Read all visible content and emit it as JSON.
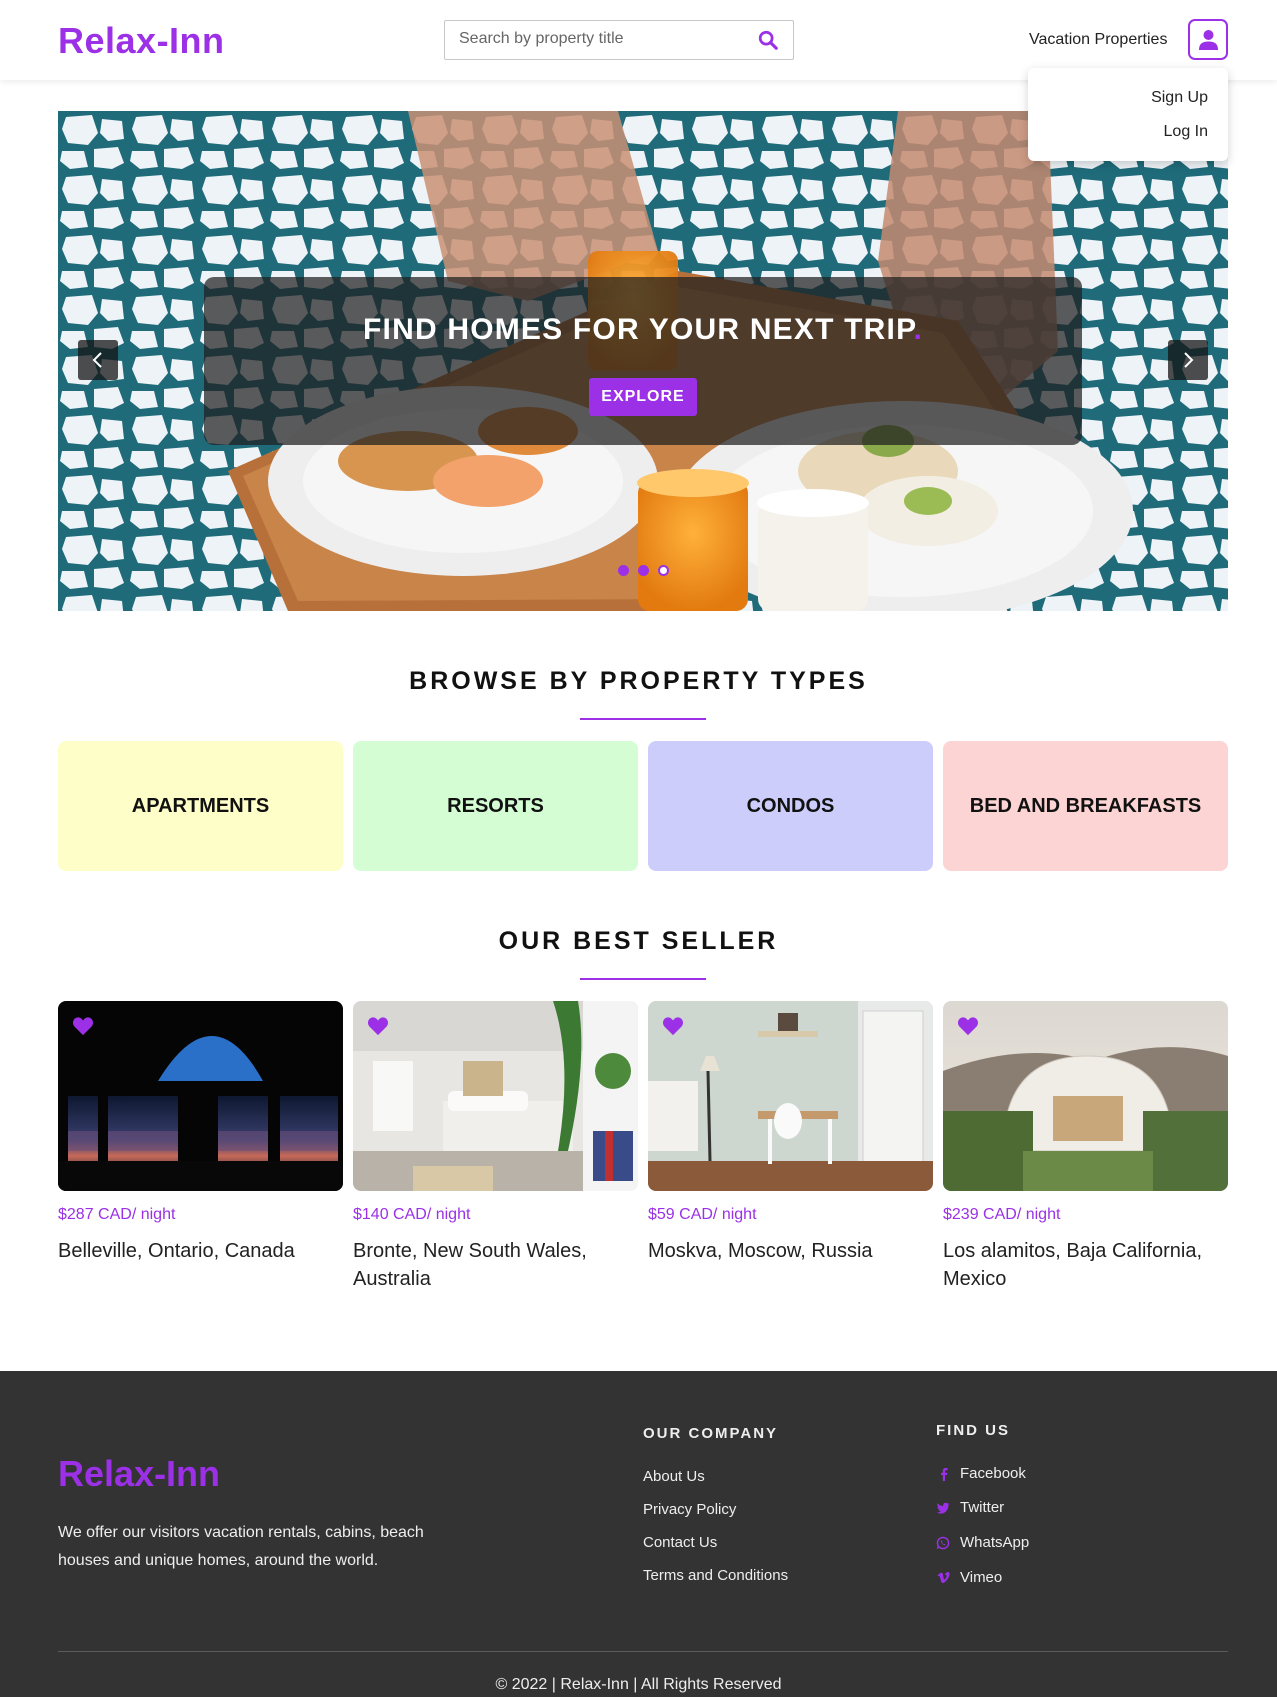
{
  "header": {
    "logo": "Relax-Inn",
    "search_placeholder": "Search by property title",
    "nav_link": "Vacation Properties",
    "dropdown": [
      "Sign Up",
      "Log In"
    ]
  },
  "hero": {
    "title": "FIND HOMES FOR YOUR NEXT TRIP",
    "title_dot": ".",
    "button": "EXPLORE",
    "slides": 3,
    "active_slide": 3
  },
  "property_types": {
    "title": "BROWSE BY PROPERTY TYPES",
    "items": [
      {
        "label": "APARTMENTS",
        "color": "#fefec8"
      },
      {
        "label": "RESORTS",
        "color": "#d4fdd4"
      },
      {
        "label": "CONDOS",
        "color": "#cdcdfc"
      },
      {
        "label": "BED AND BREAKFASTS",
        "color": "#fdd4d4"
      }
    ]
  },
  "best_seller": {
    "title": "OUR BEST SELLER",
    "items": [
      {
        "price": "$287 CAD/ night",
        "place": "Belleville, Ontario, Canada"
      },
      {
        "price": "$140 CAD/ night",
        "place": "Bronte, New South Wales, Australia"
      },
      {
        "price": "$59 CAD/ night",
        "place": "Moskva, Moscow, Russia"
      },
      {
        "price": "$239 CAD/ night",
        "place": "Los alamitos, Baja California, Mexico"
      }
    ]
  },
  "footer": {
    "logo": "Relax-Inn",
    "description": "We offer our visitors vacation rentals, cabins, beach houses and unique homes, around the world.",
    "company_title": "OUR COMPANY",
    "company_links": [
      "About Us",
      "Privacy Policy",
      "Contact Us",
      "Terms and Conditions"
    ],
    "find_title": "FIND US",
    "social": [
      {
        "label": "Facebook",
        "icon": "facebook-icon"
      },
      {
        "label": "Twitter",
        "icon": "twitter-icon"
      },
      {
        "label": "WhatsApp",
        "icon": "whatsapp-icon"
      },
      {
        "label": "Vimeo",
        "icon": "vimeo-icon"
      }
    ],
    "copyright": "© 2022 | Relax-Inn | All Rights Reserved"
  },
  "colors": {
    "accent": "#9b30e6",
    "footer_bg": "#333333"
  }
}
